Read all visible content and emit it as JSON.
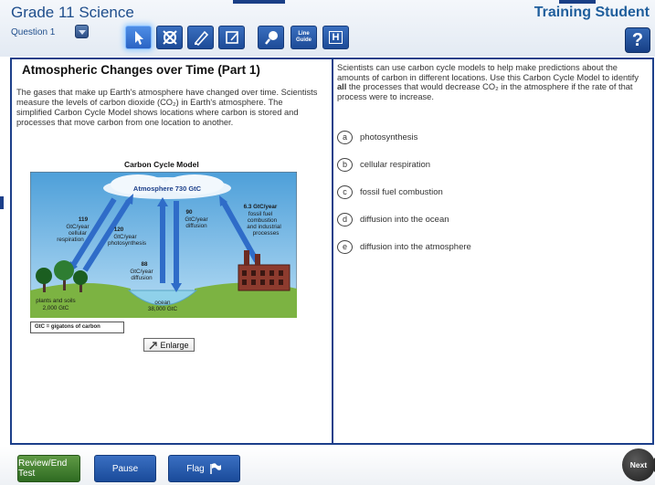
{
  "header": {
    "course_title": "Grade 11 Science",
    "student_name": "Training Student",
    "question_label": "Question 1",
    "help_label": "?",
    "tools": [
      {
        "name": "pointer",
        "label": ""
      },
      {
        "name": "strikethrough",
        "label": ""
      },
      {
        "name": "highlighter",
        "label": ""
      },
      {
        "name": "notepad",
        "label": ""
      },
      {
        "name": "magnifier",
        "label": ""
      },
      {
        "name": "line-guide",
        "label": "Line Guide"
      },
      {
        "name": "hide",
        "label": "H"
      }
    ]
  },
  "passage": {
    "title": "Atmospheric Changes over Time (Part 1)",
    "text": "The gases that make up Earth's atmosphere have changed over time. Scientists measure the levels of carbon dioxide (CO₂) in Earth's atmosphere. The simplified Carbon Cycle Model shows locations where carbon is stored and processes that move carbon from one location to another."
  },
  "diagram": {
    "title": "Carbon Cycle Model",
    "atmosphere_label": "Atmosphere 730 GtC",
    "flux_respiration": [
      "119",
      "GtC/year",
      "cellular",
      "respiration"
    ],
    "flux_photosynthesis": [
      "120",
      "GtC/year",
      "photosynthesis"
    ],
    "flux_ocean_up": [
      "88",
      "GtC/year",
      "diffusion"
    ],
    "flux_ocean_down": [
      "90",
      "GtC/year",
      "diffusion"
    ],
    "flux_fossil": [
      "6.3 GtC/year",
      "fossil fuel",
      "combustion",
      "and industrial",
      "processes"
    ],
    "plants_label": [
      "plants and soils",
      "2,000 GtC"
    ],
    "ocean_label": [
      "ocean",
      "38,000 GtC"
    ],
    "legend": "GtC = gigatons of carbon",
    "enlarge_label": "Enlarge"
  },
  "question": {
    "stem_part1": "Scientists can use carbon cycle models to help make predictions about the amounts of carbon in different locations. Use this Carbon Cycle Model to identify ",
    "stem_bold": "all",
    "stem_part2": " the processes that would decrease CO₂ in the atmosphere if the rate of that process were to increase.",
    "choices": [
      {
        "letter": "a",
        "text": "photosynthesis"
      },
      {
        "letter": "b",
        "text": "cellular respiration"
      },
      {
        "letter": "c",
        "text": "fossil fuel combustion"
      },
      {
        "letter": "d",
        "text": "diffusion into the ocean"
      },
      {
        "letter": "e",
        "text": "diffusion into the atmosphere"
      }
    ]
  },
  "footer": {
    "review_label": "Review/End Test",
    "pause_label": "Pause",
    "flag_label": "Flag",
    "next_label": "Next"
  },
  "colors": {
    "frame_blue": "#1c3f8a",
    "title_blue": "#1f4e8c",
    "review_green": "#3f7d2d"
  }
}
